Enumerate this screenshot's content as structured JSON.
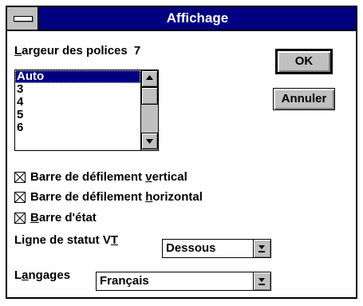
{
  "window": {
    "title": "Affichage"
  },
  "fontwidth": {
    "label_access": "L",
    "label_rest": "argeur des polices",
    "value": "7"
  },
  "list": {
    "items": [
      "Auto",
      "3",
      "4",
      "5",
      "6"
    ],
    "selected": "Auto"
  },
  "buttons": {
    "ok": "OK",
    "cancel": "Annuler"
  },
  "checkboxes": [
    {
      "pre": "Barre de défilement ",
      "acc": "v",
      "post": "ertical",
      "checked": true
    },
    {
      "pre": "Barre de défilement ",
      "acc": "h",
      "post": "orizontal",
      "checked": true
    },
    {
      "pre": "",
      "acc": "B",
      "post": "arre d'état",
      "checked": true
    }
  ],
  "vt_status": {
    "label_pre": "Ligne de statut V",
    "label_acc": "T",
    "value": "Dessous"
  },
  "language": {
    "label_pre": "L",
    "label_acc": "a",
    "label_post": "ngages",
    "value": "Français"
  }
}
